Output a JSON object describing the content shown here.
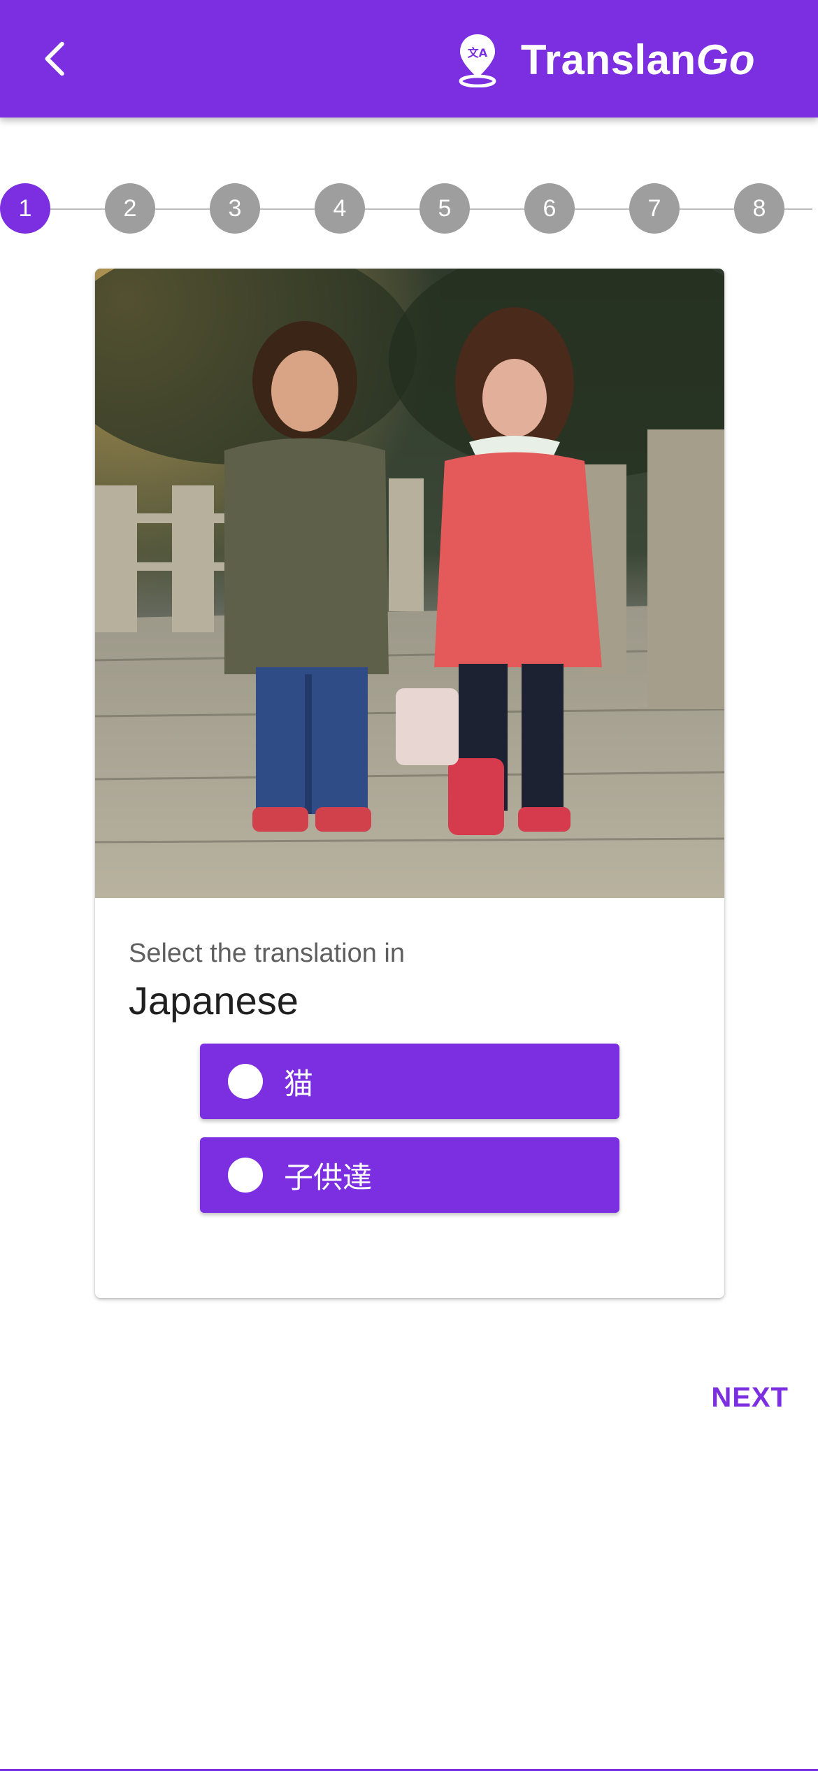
{
  "app": {
    "title_plain": "Translan",
    "title_italic": "Go",
    "accent_color": "#7b2fe0",
    "back_icon": "chevron-left-icon",
    "logo_icon": "location-translate-icon"
  },
  "stepper": {
    "active_step": 1,
    "steps": [
      "1",
      "2",
      "3",
      "4",
      "5",
      "6",
      "7",
      "8"
    ]
  },
  "quiz": {
    "image_alt": "Two children standing on a stone path",
    "prompt": "Select the translation in",
    "language": "Japanese",
    "options": [
      {
        "label": "猫",
        "selected": false
      },
      {
        "label": "子供達",
        "selected": false
      }
    ]
  },
  "footer": {
    "next_label": "NEXT"
  }
}
